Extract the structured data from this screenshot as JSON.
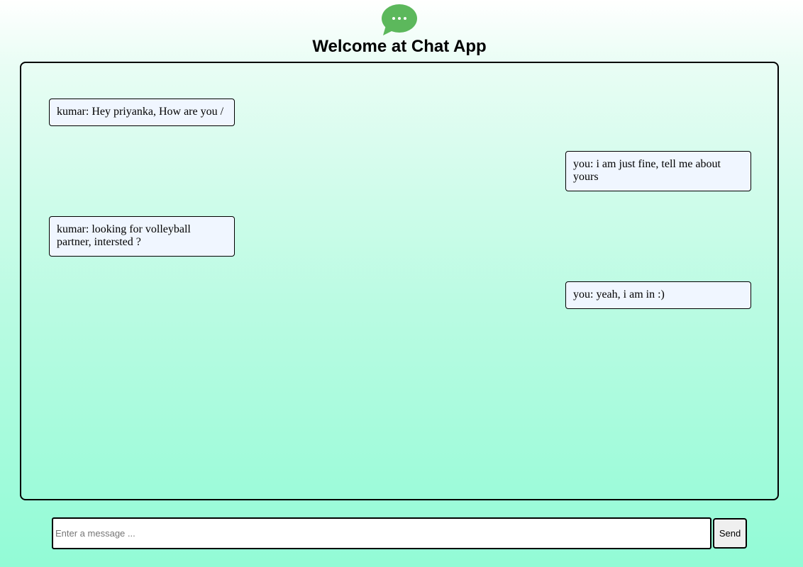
{
  "header": {
    "logo_icon": "chat-bubble-icon",
    "logo_color": "#5cb85c",
    "title": "Welcome at Chat App"
  },
  "messages": [
    {
      "side": "left",
      "text": "kumar: Hey priyanka, How are you /"
    },
    {
      "side": "right",
      "text": "you: i am just fine, tell me about yours"
    },
    {
      "side": "left",
      "text": "kumar: looking for volleyball partner, intersted ?"
    },
    {
      "side": "right",
      "text": "you: yeah, i am in :)"
    }
  ],
  "composer": {
    "value": "",
    "placeholder": "Enter a message ...",
    "send_label": "Send"
  }
}
